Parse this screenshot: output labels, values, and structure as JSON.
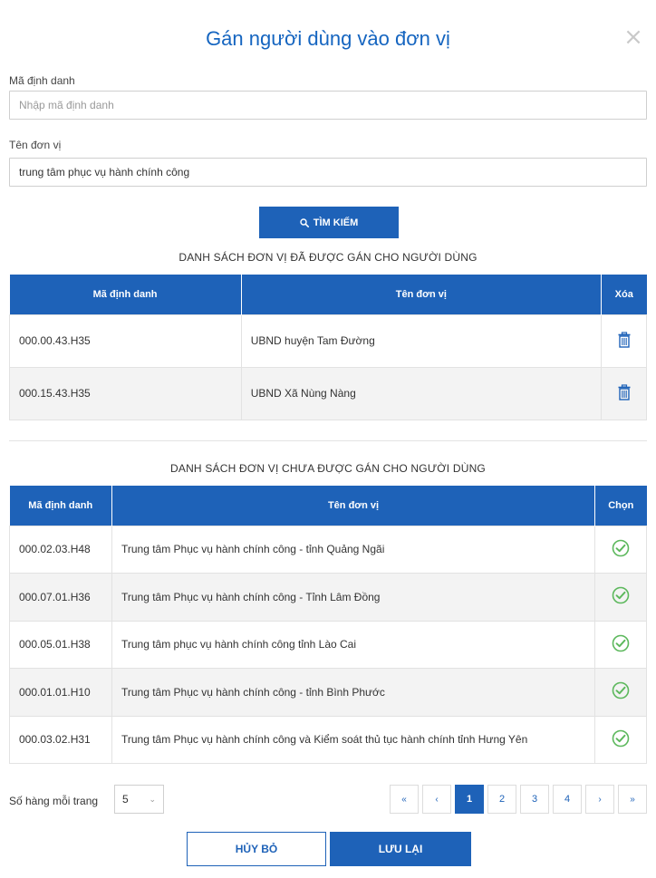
{
  "dialog": {
    "title": "Gán người dùng vào đơn vị",
    "close_glyph": "×"
  },
  "form": {
    "id_label": "Mã định danh",
    "id_value": "",
    "id_placeholder": "Nhập mã định danh",
    "unit_label": "Tên đơn vị",
    "unit_value": "trung tâm phục vụ hành chính công",
    "search_label": "TÌM KIẾM"
  },
  "assigned": {
    "title": "DANH SÁCH ĐƠN VỊ ĐÃ ĐƯỢC GÁN CHO NGƯỜI DÙNG",
    "columns": [
      "Mã định danh",
      "Tên đơn vị",
      "Xóa"
    ],
    "rows": [
      {
        "code": "000.00.43.H35",
        "name": "UBND huyện Tam Đường"
      },
      {
        "code": "000.15.43.H35",
        "name": "UBND Xã Nùng Nàng"
      }
    ]
  },
  "unassigned": {
    "title": "DANH SÁCH ĐƠN VỊ CHƯA ĐƯỢC GÁN CHO NGƯỜI DÙNG",
    "columns": [
      "Mã định danh",
      "Tên đơn vị",
      "Chọn"
    ],
    "rows": [
      {
        "code": "000.02.03.H48",
        "name": "Trung tâm Phục vụ hành chính công - tỉnh Quảng Ngãi"
      },
      {
        "code": "000.07.01.H36",
        "name": "Trung tâm Phục vụ hành chính công - Tỉnh Lâm Đồng"
      },
      {
        "code": "000.05.01.H38",
        "name": "Trung tâm phục vụ hành chính công tỉnh Lào Cai"
      },
      {
        "code": "000.01.01.H10",
        "name": "Trung tâm Phục vụ hành chính công - tỉnh Bình Phước"
      },
      {
        "code": "000.03.02.H31",
        "name": "Trung tâm Phục vụ hành chính công và Kiểm soát thủ tục hành chính tỉnh Hưng Yên"
      }
    ]
  },
  "pagination": {
    "rows_per_page_label": "Số hàng mỗi trang",
    "rows_per_page_value": "5",
    "first": "«",
    "prev": "‹",
    "pages": [
      "1",
      "2",
      "3",
      "4"
    ],
    "current_page": "1",
    "next": "›",
    "last": "»"
  },
  "footer": {
    "cancel_label": "HỦY BỎ",
    "save_label": "LƯU LẠI"
  },
  "colors": {
    "primary": "#1e62b8",
    "title": "#1565c0",
    "check": "#5cb85c"
  },
  "icons": {
    "search": "search-icon",
    "trash": "trash-icon",
    "check": "check-circle-icon",
    "close": "close-icon",
    "dropdown": "chevron-down-icon"
  }
}
